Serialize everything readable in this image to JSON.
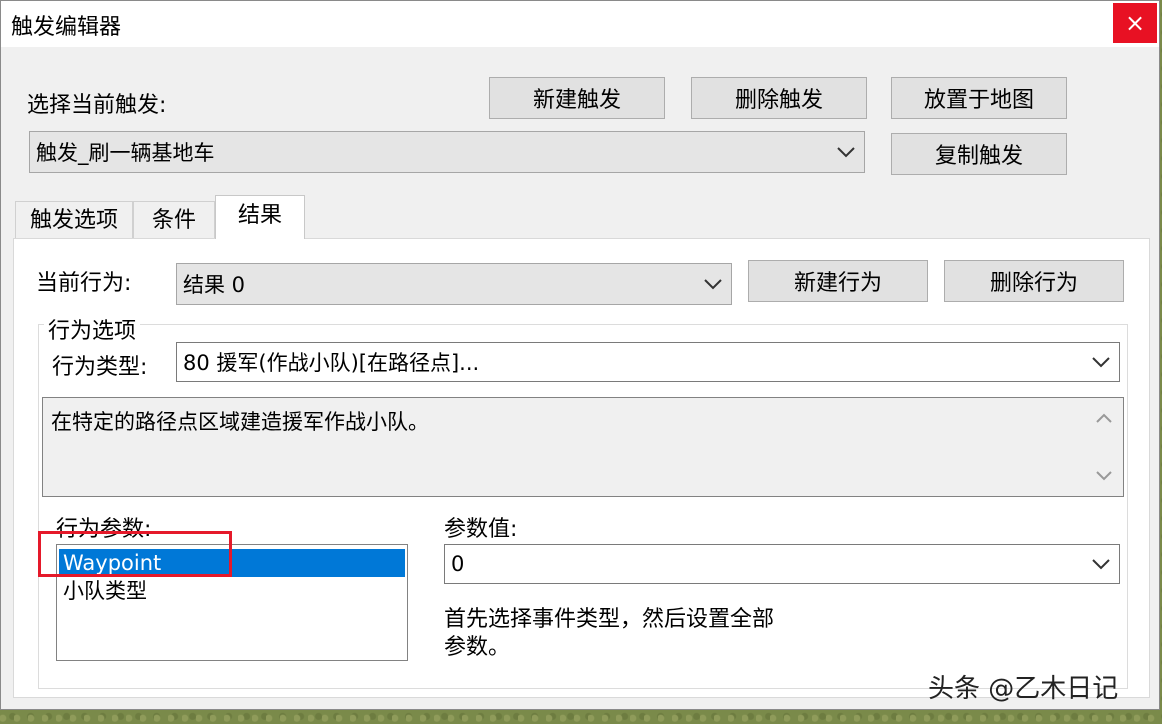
{
  "window": {
    "title": "触发编辑器",
    "close_icon": "×"
  },
  "top": {
    "select_label": "选择当前触发:",
    "new_trigger": "新建触发",
    "delete_trigger": "删除触发",
    "place_on_map": "放置于地图",
    "copy_trigger": "复制触发",
    "current_trigger": "触发_刷一辆基地车"
  },
  "tabs": [
    {
      "label": "触发选项"
    },
    {
      "label": "条件"
    },
    {
      "label": "结果"
    }
  ],
  "results": {
    "current_action_label": "当前行为:",
    "current_action_value": "结果 0",
    "new_action": "新建行为",
    "delete_action": "删除行为",
    "group_title": "行为选项",
    "action_type_label": "行为类型:",
    "action_type_value": "80 援军(作战小队)[在路径点]...",
    "description": "在特定的路径点区域建造援军作战小队。",
    "params_label": "行为参数:",
    "params": [
      "Waypoint",
      "小队类型"
    ],
    "param_value_label": "参数值:",
    "param_value": "0",
    "hint_line1": "首先选择事件类型，然后设置全部",
    "hint_line2": "参数。"
  },
  "watermark": "头条 @乙木日记",
  "colors": {
    "close": "#e81123",
    "selection": "#0078d7",
    "highlight_box": "#e5192a"
  }
}
